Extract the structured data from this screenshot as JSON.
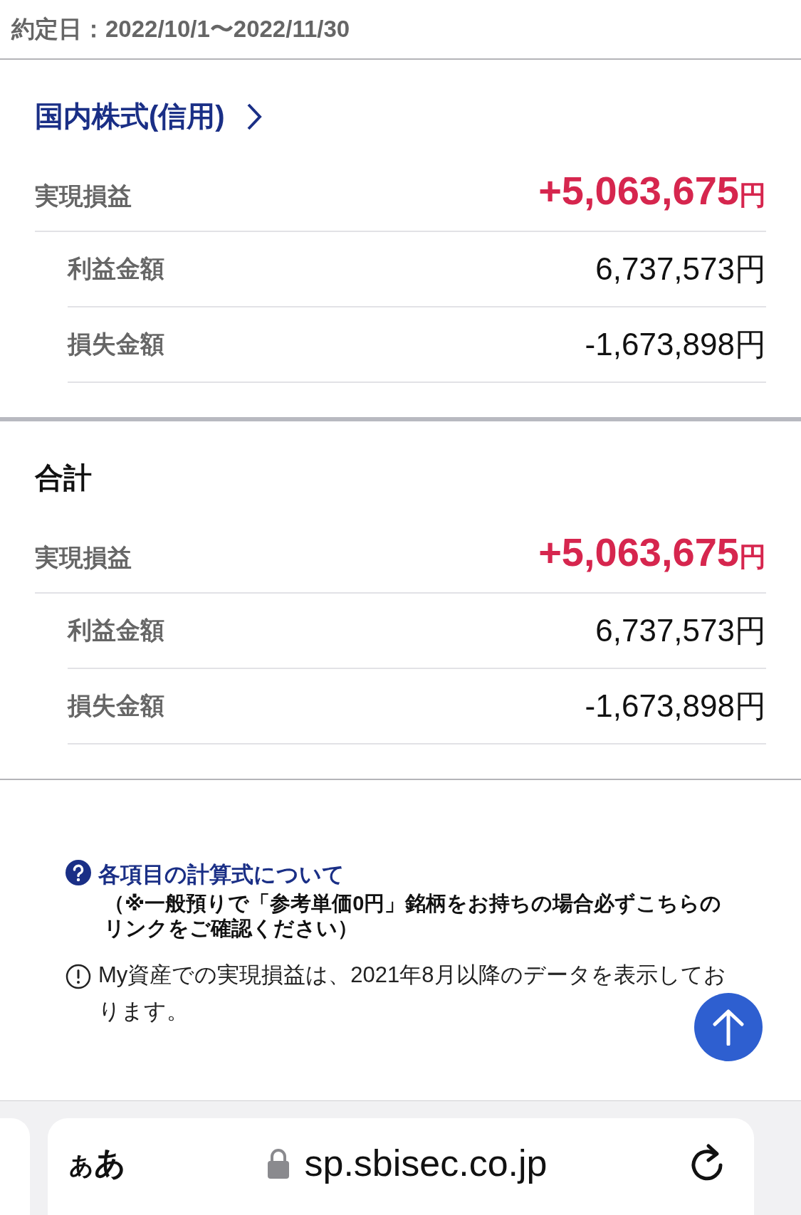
{
  "date_range": "約定日：2022/10/1〜2022/11/30",
  "sections": [
    {
      "kind": "link",
      "title": "国内株式(信用)",
      "realized": {
        "label": "実現損益",
        "value": "+5,063,675",
        "unit": "円"
      },
      "rows": [
        {
          "label": "利益金額",
          "value": "6,737,573円"
        },
        {
          "label": "損失金額",
          "value": "-1,673,898円"
        }
      ]
    },
    {
      "kind": "total",
      "title": "合計",
      "realized": {
        "label": "実現損益",
        "value": "+5,063,675",
        "unit": "円"
      },
      "rows": [
        {
          "label": "利益金額",
          "value": "6,737,573円"
        },
        {
          "label": "損失金額",
          "value": "-1,673,898円"
        }
      ]
    }
  ],
  "help": {
    "link": "各項目の計算式について",
    "note": "（※一般預りで「参考単価0円」銘柄をお持ちの場合必ずこちらのリンクをご確認ください）"
  },
  "info": "My資産での実現損益は、2021年8月以降のデータを表示しております。",
  "browser": {
    "text_size": "ああ",
    "url": "sp.sbisec.co.jp"
  }
}
